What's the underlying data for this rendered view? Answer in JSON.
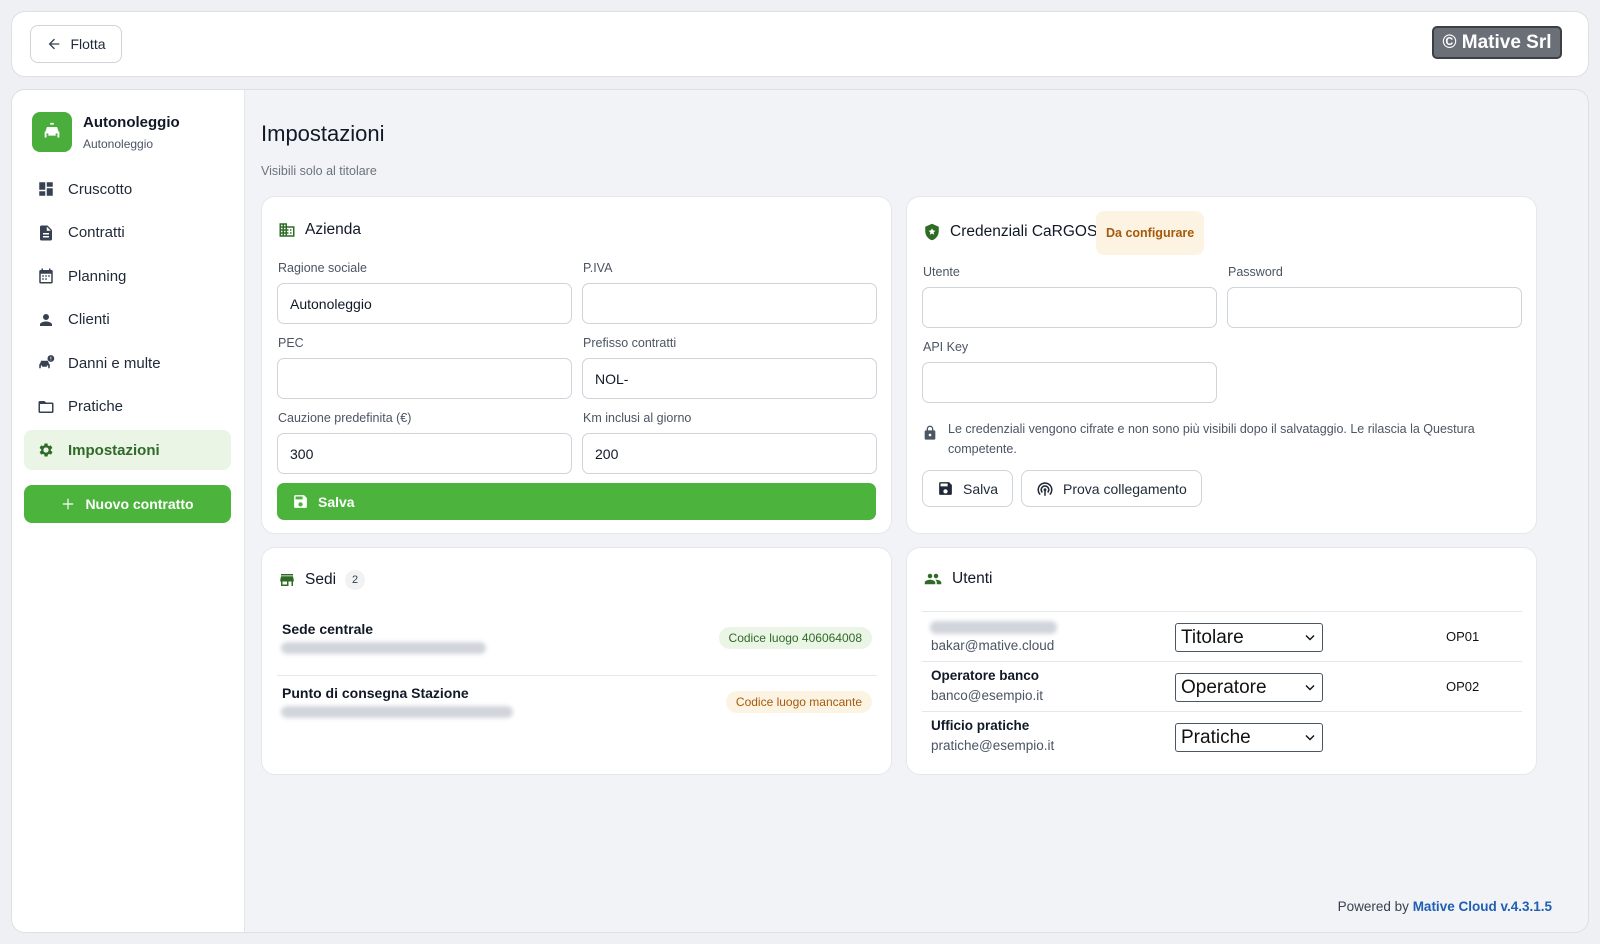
{
  "topbar": {
    "back_label": "Flotta",
    "brand_badge": "© Mative Srl"
  },
  "sidebar": {
    "brand_name": "Autonoleggio",
    "brand_sub": "Autonoleggio",
    "items": [
      {
        "label": "Cruscotto",
        "icon": "dashboard-icon"
      },
      {
        "label": "Contratti",
        "icon": "document-icon"
      },
      {
        "label": "Planning",
        "icon": "calendar-icon"
      },
      {
        "label": "Clienti",
        "icon": "person-icon"
      },
      {
        "label": "Danni e multe",
        "icon": "car-warning-icon"
      },
      {
        "label": "Pratiche",
        "icon": "folder-icon"
      },
      {
        "label": "Impostazioni",
        "icon": "gear-icon",
        "active": true
      }
    ],
    "new_contract_label": "Nuovo contratto"
  },
  "page": {
    "title": "Impostazioni",
    "subtitle": "Visibili solo al titolare"
  },
  "azienda": {
    "title": "Azienda",
    "fields": {
      "ragione_label": "Ragione sociale",
      "ragione_value": "Autonoleggio",
      "piva_label": "P.IVA",
      "piva_value": "",
      "pec_label": "PEC",
      "pec_value": "",
      "prefisso_label": "Prefisso contratti",
      "prefisso_value": "NOL-",
      "cauzione_label": "Cauzione predefinita (€)",
      "cauzione_value": "300",
      "km_label": "Km inclusi al giorno",
      "km_value": "200"
    },
    "save_label": "Salva"
  },
  "cargos": {
    "title": "Credenziali CaRGOS",
    "status_badge": "Da configurare",
    "utente_label": "Utente",
    "utente_value": "",
    "password_label": "Password",
    "password_value": "",
    "apikey_label": "API Key",
    "apikey_value": "",
    "note": "Le credenziali vengono cifrate e non sono più visibili dopo il salvataggio. Le rilascia la Questura competente.",
    "save_label": "Salva",
    "test_label": "Prova collegamento"
  },
  "sedi": {
    "title": "Sedi",
    "count": "2",
    "items": [
      {
        "name": "Sede centrale",
        "badge": "Codice luogo 406064008",
        "status": "ok"
      },
      {
        "name": "Punto di consegna Stazione",
        "badge": "Codice luogo mancante",
        "status": "missing"
      }
    ]
  },
  "utenti": {
    "title": "Utenti",
    "rows": [
      {
        "name": "",
        "email": "bakar@mative.cloud",
        "role": "Titolare",
        "code": "OP01"
      },
      {
        "name": "Operatore banco",
        "email": "banco@esempio.it",
        "role": "Operatore",
        "code": "OP02"
      },
      {
        "name": "Ufficio pratiche",
        "email": "pratiche@esempio.it",
        "role": "Pratiche",
        "code": ""
      }
    ]
  },
  "footer": {
    "prefix": "Powered by",
    "version": "Mative Cloud v.4.3.1.5"
  },
  "colors": {
    "accent": "#4cb43c",
    "active_bg": "#eaf5e6",
    "warn_bg": "#fdf3e3",
    "warn_text": "#a45a0b",
    "link": "#1f5fb4"
  }
}
